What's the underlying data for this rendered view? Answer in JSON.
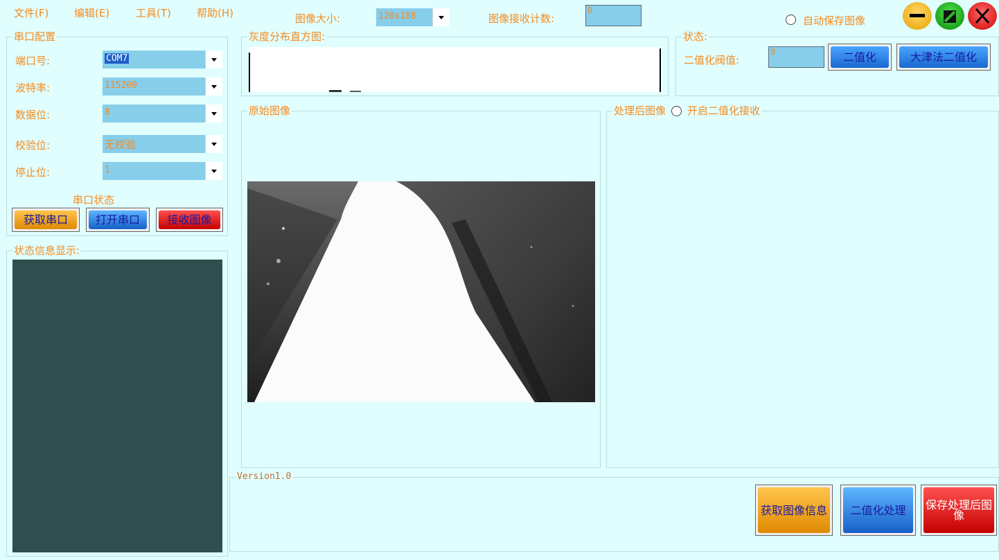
{
  "menu": [
    "文件(F)",
    "编辑(E)",
    "工具(T)",
    "帮助(H)"
  ],
  "toolbar": {
    "image_size_label": "图像大小:",
    "image_size_value": "120x188",
    "recv_count_label": "图像接收计数:",
    "recv_count_value": "0",
    "auto_save_label": "自动保存图像"
  },
  "serial": {
    "title": "串口配置",
    "port_label": "端口号:",
    "port_value": "COM7",
    "baud_label": "波特率:",
    "baud_value": "115200",
    "databits_label": "数据位:",
    "databits_value": "8",
    "parity_label": "校验位:",
    "parity_value": "无校验",
    "stopbits_label": "停止位:",
    "stopbits_value": "1",
    "status_text": "串口状态",
    "get_port_btn": "获取串口",
    "open_port_btn": "打开串口",
    "receive_btn": "接收图像"
  },
  "status_info": {
    "title": "状态信息显示:"
  },
  "histogram": {
    "title": "灰度分布直方图:"
  },
  "state": {
    "title": "状态:",
    "threshold_label": "二值化阀值:",
    "threshold_value": "0",
    "binarize_btn": "二值化",
    "otsu_btn": "大津法二值化"
  },
  "original": {
    "title": "原始图像"
  },
  "processed": {
    "title": "处理后图像",
    "enable_label": "开启二值化接收"
  },
  "version": "Version1.0",
  "actions": {
    "get_info_btn": "获取图像信息",
    "binarize_proc_btn": "二值化处理",
    "save_btn": "保存处理后图像"
  },
  "colors": {
    "background": "#e0fefe",
    "label_text": "#f58a1f",
    "field": "#87ceeb",
    "status_panel": "#2f4f4f"
  },
  "icons": [
    "minimize-icon",
    "maximize-icon",
    "close-icon"
  ]
}
